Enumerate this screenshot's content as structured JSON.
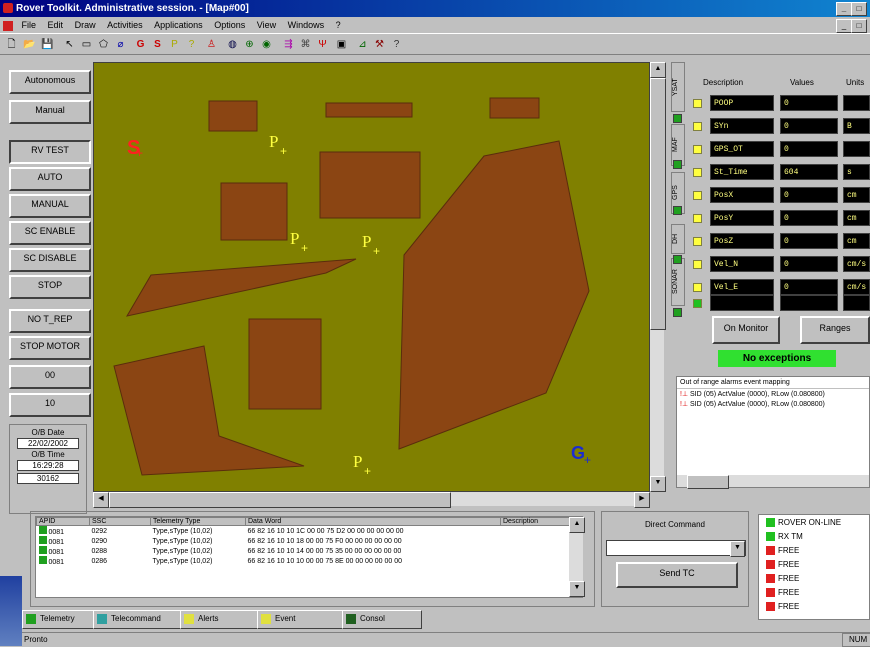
{
  "window": {
    "title": "Rover Toolkit. Administrative session. - [Map#00]"
  },
  "menu": [
    "File",
    "Edit",
    "Draw",
    "Activities",
    "Applications",
    "Options",
    "View",
    "Windows",
    "?"
  ],
  "left_buttons": [
    "Autonomous",
    "Manual",
    "RV TEST",
    "AUTO",
    "MANUAL",
    "SC ENABLE",
    "SC DISABLE",
    "STOP",
    "NO T_REP",
    "STOP MOTOR",
    "00",
    "10"
  ],
  "obt": {
    "date_label": "O/B Date",
    "date": "22/02/2002",
    "time_label": "O/B Time",
    "time": "16:29:28",
    "counter": "30162"
  },
  "map": {
    "start_label": "S",
    "goal_label": "G",
    "waypoint_label": "P",
    "background": "#808000",
    "obstacle_color": "#8b4513"
  },
  "side_tabs": [
    "YSAT",
    "MAF",
    "GPS",
    "DH",
    "SONAR"
  ],
  "table": {
    "headers": [
      "Description",
      "Values",
      "Units"
    ],
    "rows": [
      {
        "desc": "POOP",
        "value": "0",
        "unit": ""
      },
      {
        "desc": "SYn",
        "value": "0",
        "unit": "B"
      },
      {
        "desc": "GPS_OT",
        "value": "0",
        "unit": ""
      },
      {
        "desc": "St_Time",
        "value": "604",
        "unit": "s"
      },
      {
        "desc": "PosX",
        "value": "0",
        "unit": "cm"
      },
      {
        "desc": "PosY",
        "value": "0",
        "unit": "cm"
      },
      {
        "desc": "PosZ",
        "value": "0",
        "unit": "cm"
      },
      {
        "desc": "Vel_N",
        "value": "0",
        "unit": "cm/s"
      },
      {
        "desc": "Vel_E",
        "value": "0",
        "unit": "cm/s"
      },
      {
        "desc": "",
        "value": "",
        "unit": ""
      }
    ]
  },
  "buttons": {
    "monitor": "On Monitor",
    "ranges": "Ranges"
  },
  "exceptions": {
    "status": "No exceptions",
    "log_title": "Out of range alarms event mapping",
    "log": [
      "SID (05) ActValue (0000), RLow (0.080800)",
      "SID (05) ActValue (0000), RLow (0.080800)"
    ]
  },
  "telemetry": {
    "headers": [
      "APID",
      "SSC",
      "Telemetry Type",
      "Data Word",
      "Description"
    ],
    "rows": [
      [
        "0081",
        "0292",
        "Type,sType (10,02)",
        "66 82 16 10 10 1C 00 00 75 D2 00 00 00 00 00 00",
        ""
      ],
      [
        "0081",
        "0290",
        "Type,sType (10,02)",
        "66 82 16 10 10 18 00 00 75 F0 00 00 00 00 00 00",
        ""
      ],
      [
        "0081",
        "0288",
        "Type,sType (10,02)",
        "66 82 16 10 10 14 00 00 75 35 00 00 00 00 00 00",
        ""
      ],
      [
        "0081",
        "0286",
        "Type,sType (10,02)",
        "66 82 16 10 10 10 00 00 75 8E 00 00 00 00 00 00",
        ""
      ]
    ]
  },
  "command": {
    "label": "Direct Command",
    "send": "Send TC"
  },
  "status_list": [
    {
      "text": "ROVER ON-LINE",
      "color": "#20c020"
    },
    {
      "text": "RX TM",
      "color": "#20c020"
    },
    {
      "text": "FREE",
      "color": "#e02020"
    },
    {
      "text": "FREE",
      "color": "#e02020"
    },
    {
      "text": "FREE",
      "color": "#e02020"
    },
    {
      "text": "FREE",
      "color": "#e02020"
    },
    {
      "text": "FREE",
      "color": "#e02020"
    }
  ],
  "bottom_tabs": [
    "Telemetry",
    "Telecommand",
    "Alerts",
    "Event",
    "Consol"
  ],
  "statusbar": {
    "left": "Pronto",
    "right": "NUM"
  }
}
